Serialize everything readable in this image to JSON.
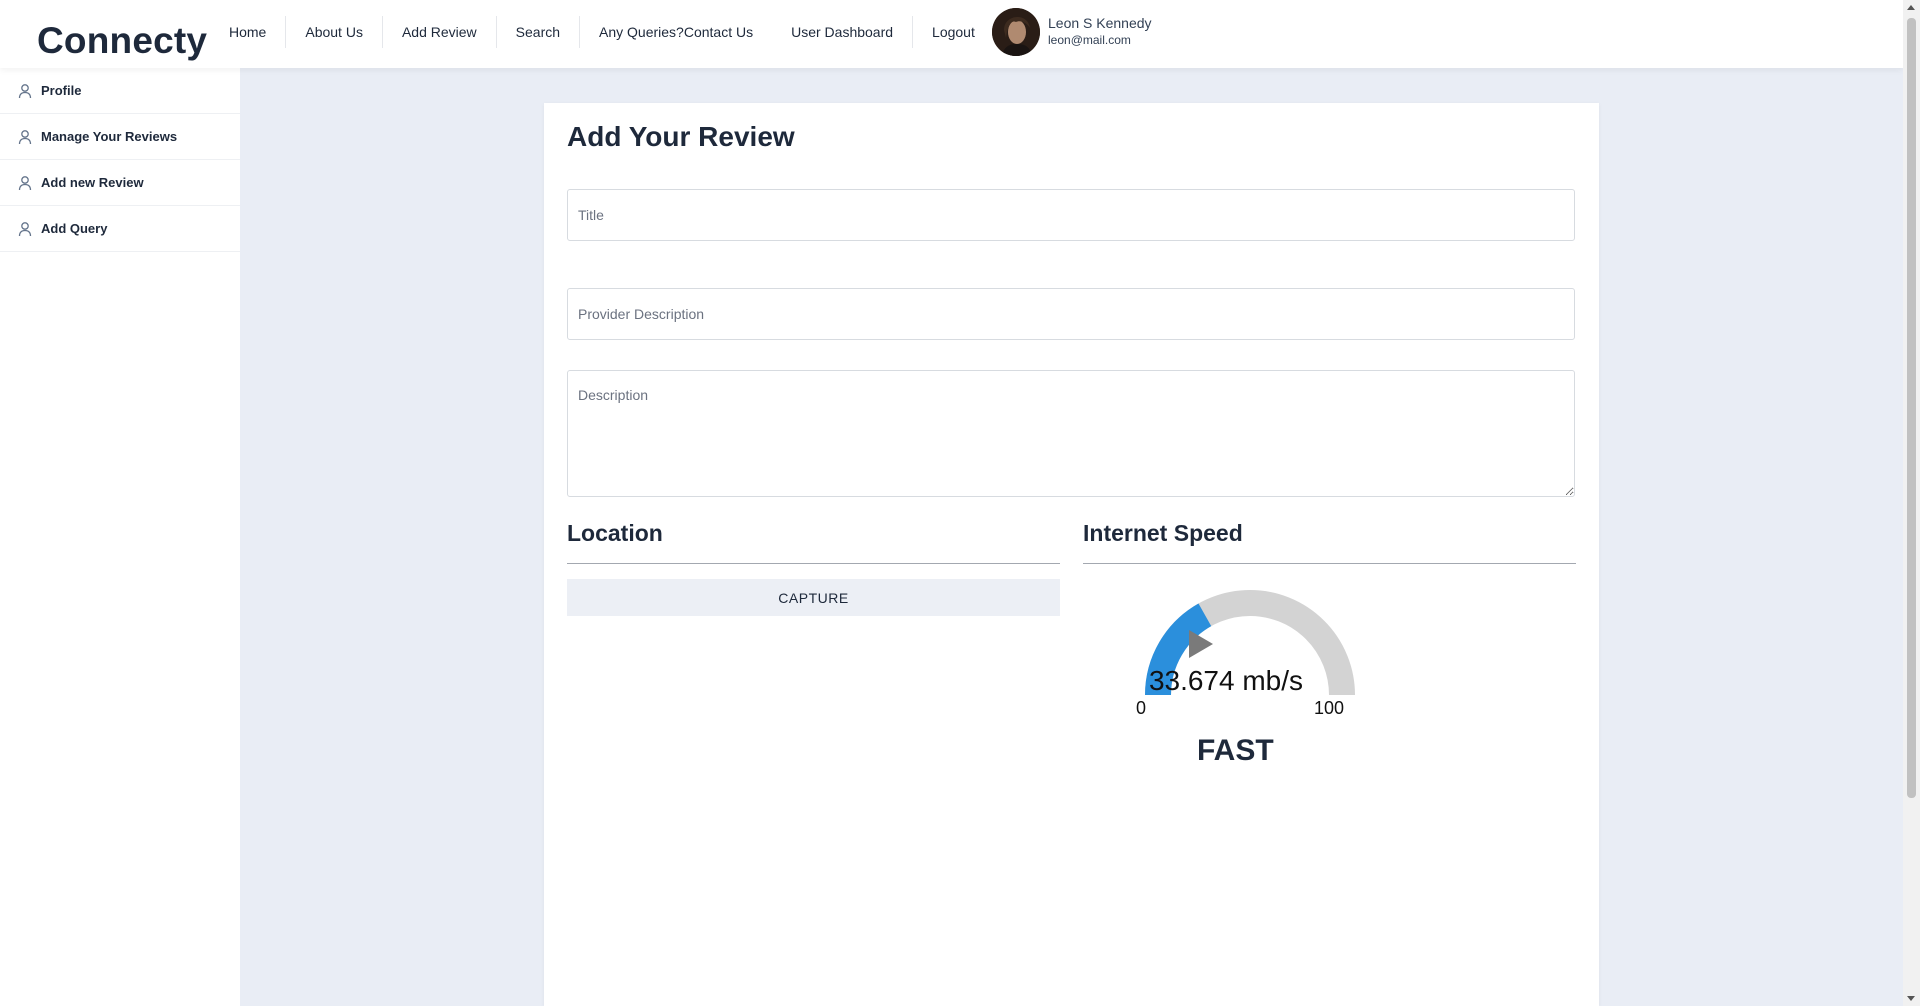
{
  "brand": "Connecty",
  "nav": {
    "items": [
      "Home",
      "About Us",
      "Add Review",
      "Search",
      "Any Queries?Contact Us",
      "User Dashboard",
      "Logout"
    ]
  },
  "user": {
    "name": "Leon S Kennedy",
    "email": "leon@mail.com"
  },
  "sidebar": {
    "items": [
      "Profile",
      "Manage Your Reviews",
      "Add new Review",
      "Add Query"
    ]
  },
  "form": {
    "heading": "Add Your Review",
    "title_placeholder": "Title",
    "provider_placeholder": "Provider Description",
    "description_placeholder": "Description"
  },
  "location": {
    "heading": "Location",
    "capture_label": "CAPTURE"
  },
  "speed": {
    "heading": "Internet Speed",
    "value_label": "33.674 mb/s",
    "value": 33.674,
    "min_label": "0",
    "max_label": "100",
    "min": 0,
    "max": 100,
    "status": "FAST",
    "fill_color": "#2b8fdc",
    "track_color": "#d3d3d3"
  },
  "colors": {
    "page_bg": "#e9edf5",
    "text": "#1e293b",
    "button_bg": "#eceff5"
  }
}
